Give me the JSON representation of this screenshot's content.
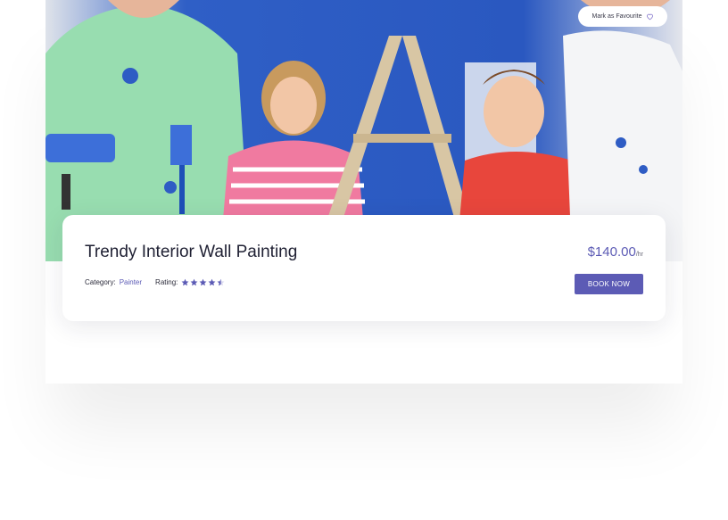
{
  "favourite_button": {
    "label": "Mark as Favourite",
    "icon": "heart-outline-icon"
  },
  "listing": {
    "title": "Trendy Interior Wall Painting",
    "price": "$140.00",
    "price_unit": "/hr",
    "category_label": "Category:",
    "category_value": "Painter",
    "rating_label": "Rating:",
    "rating_value": 4.5,
    "rating_max": 5,
    "book_button_label": "BOOK NOW"
  },
  "colors": {
    "accent": "#5c5bb5",
    "title_text": "#1f2033",
    "wall_blue": "#2e5cc4"
  }
}
